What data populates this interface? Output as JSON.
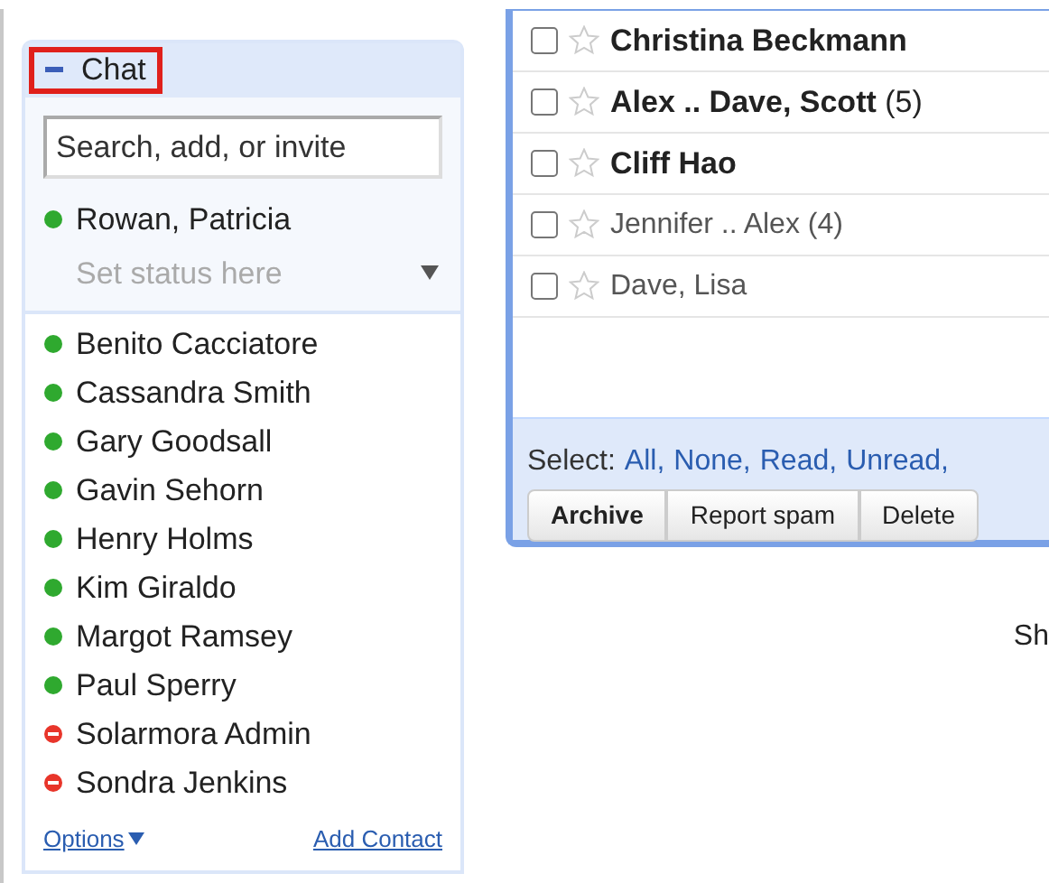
{
  "chat": {
    "title": "Chat",
    "expanded": true,
    "search": {
      "placeholder": "Search, add, or invite"
    },
    "me": {
      "name": "Rowan, Patricia",
      "kind": "available",
      "status_message": {
        "placeholder": "Set status here"
      }
    },
    "contacts": [
      {
        "name": "Benito Cacciatore",
        "kind": "available"
      },
      {
        "name": "Cassandra Smith",
        "kind": "available"
      },
      {
        "name": "Gary Goodsall",
        "kind": "available"
      },
      {
        "name": "Gavin Sehorn",
        "kind": "available"
      },
      {
        "name": "Henry Holms",
        "kind": "available"
      },
      {
        "name": "Kim Giraldo",
        "kind": "available"
      },
      {
        "name": "Margot Ramsey",
        "kind": "available"
      },
      {
        "name": "Paul Sperry",
        "kind": "available"
      },
      {
        "name": "Solarmora Admin",
        "kind": "busy"
      },
      {
        "name": "Sondra Jenkins",
        "kind": "busy"
      }
    ],
    "footer": {
      "options": "Options",
      "add_contact": "Add Contact"
    }
  },
  "mail": {
    "rows": [
      {
        "sender": "Christina Beckmann",
        "unread": true,
        "checked": false,
        "starred": false
      },
      {
        "sender": "Alex .. Dave, Scott",
        "count": "(5)",
        "unread": true,
        "checked": false,
        "starred": false
      },
      {
        "sender": "Cliff Hao",
        "unread": true,
        "checked": false,
        "starred": false
      },
      {
        "sender": "Jennifer .. Alex",
        "count": "(4)",
        "unread": false,
        "checked": false,
        "starred": false
      },
      {
        "sender": "Dave, Lisa",
        "unread": false,
        "checked": false,
        "starred": false
      }
    ],
    "select_label": "Select:",
    "select_links": [
      "All,",
      "None,",
      "Read,",
      "Unread,"
    ],
    "buttons": [
      "Archive",
      "Report spam",
      "Delete"
    ]
  },
  "side_text": "Sh"
}
